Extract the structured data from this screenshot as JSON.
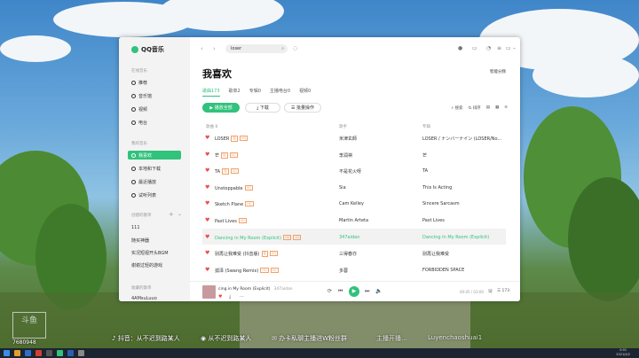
{
  "app": {
    "name": "QQ音乐"
  },
  "search": {
    "value": "loser",
    "icon": "search-icon"
  },
  "sidebar": {
    "online_section": "在线音乐",
    "online_items": [
      {
        "label": "推荐",
        "icon": "recommend-icon"
      },
      {
        "label": "音乐馆",
        "icon": "music-hall-icon"
      },
      {
        "label": "视频",
        "icon": "video-icon"
      },
      {
        "label": "电台",
        "icon": "radio-icon"
      }
    ],
    "my_section": "我的音乐",
    "my_items": [
      {
        "label": "我喜欢",
        "icon": "heart-icon",
        "active": true
      },
      {
        "label": "本地和下载",
        "icon": "download-icon"
      },
      {
        "label": "最近播放",
        "icon": "recent-icon"
      },
      {
        "label": "试听列表",
        "icon": "list-icon"
      }
    ],
    "created_section": "创建的歌单",
    "created_items": [
      "111",
      "随买神器",
      "实况短视开头BGM",
      "谢谢过轻的游戏"
    ],
    "collected_section": "收藏的歌单",
    "collected_items": [
      "4AMsuLuuo"
    ]
  },
  "main": {
    "title": "我喜欢",
    "smart_play": "智能分频",
    "tabs": [
      "歌曲173",
      "歌单2",
      "专辑0",
      "主播电台0",
      "视频0"
    ],
    "buttons": {
      "play_all": "播放全部",
      "download": "下载",
      "batch": "批量操作"
    },
    "tools": {
      "search": "搜索",
      "sort": "排序"
    },
    "columns": {
      "song": "歌曲 8",
      "singer": "歌手",
      "album": "专辑"
    }
  },
  "songs": [
    {
      "title": "LOSER",
      "singer": "米津玄師",
      "album": "LOSER / ナンバーナイン (LOSER/No..."
    },
    {
      "title": "芒",
      "singer": "李润祺",
      "album": "芒"
    },
    {
      "title": "TA",
      "singer": "不是花火呀",
      "album": "TA"
    },
    {
      "title": "Unstoppable",
      "singer": "Sia",
      "album": "This Is Acting"
    },
    {
      "title": "Sketch Plane",
      "singer": "Cam Kelley",
      "album": "Sincere Sarcasm"
    },
    {
      "title": "Past Lives",
      "singer": "Martin Arteta",
      "album": "Past Lives"
    },
    {
      "title": "Dancing in My Room (Explicit)",
      "singer": "347aidan",
      "album": "Dancing In My Room (Explicit)",
      "playing": true
    },
    {
      "title": "别再让我难受 (抖音版)",
      "singer": "三得春亦",
      "album": "别再让我难受"
    },
    {
      "title": "孤泽 (Swang Remix)",
      "singer": "多蓉",
      "album": "FORBIDDEN SPACE"
    }
  ],
  "player": {
    "now_playing": "cing in My Room (Explicit)",
    "artist": "347aidan",
    "time": "00:05 / 03:00",
    "count": "173"
  },
  "overlay": {
    "tiktok": "抖音：从不迟到路某人",
    "weibo": "从不迟到路某人",
    "wechat": "办卡私聊主播进W粉丝群",
    "partial": "主播开播...",
    "handle": "Luyenchaoshuai1",
    "watermark": "斗鱼",
    "room_number": "7680948"
  },
  "clock": {
    "time": "0:01",
    "date": "2021/4/2"
  }
}
